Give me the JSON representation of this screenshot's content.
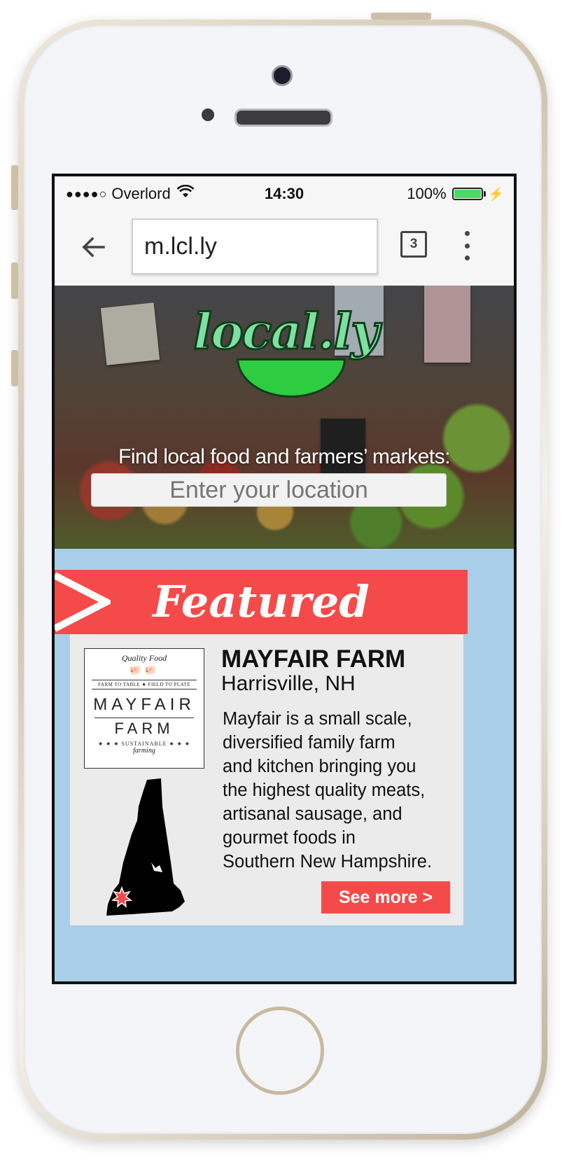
{
  "status_bar": {
    "signal": "●●●●○",
    "carrier": "Overlord",
    "time": "14:30",
    "battery_percent": "100%",
    "battery_level": 1.0
  },
  "browser": {
    "url": "m.lcl.ly",
    "tab_count": "3"
  },
  "hero": {
    "logo_text": "local.ly",
    "tagline": "Find local food and farmers’ markets:",
    "location_placeholder": "Enter your location"
  },
  "featured": {
    "banner_title": "Featured",
    "farm": {
      "name": "MAYFAIR FARM",
      "location": "Harrisville, NH",
      "description": "Mayfair is a small scale,\ndiversified family farm\nand kitchen bringing you\nthe highest quality meats,\nartisanal sausage, and\ngourmet foods in\nSouthern New Hampshire.",
      "see_more_label": "See more >",
      "logo": {
        "top": "Quality Food",
        "tag": "FARM TO TABLE ★ FIELD TO PLATE",
        "name_line1": "MAYFAIR",
        "name_line2": "FARM",
        "bottom": "★ ★ ★ SUSTAINABLE ★ ★ ★",
        "bottom2": "farming"
      }
    }
  },
  "colors": {
    "accent_red": "#f44a4a",
    "section_blue": "#a9cfe8",
    "card_gray": "#ebebeb",
    "battery_green": "#4cd964"
  },
  "icons": {
    "back": "arrow-left-icon",
    "menu": "more-vertical-icon",
    "tabs": "tabs-icon",
    "wifi": "wifi-icon",
    "charging": "bolt-icon"
  }
}
